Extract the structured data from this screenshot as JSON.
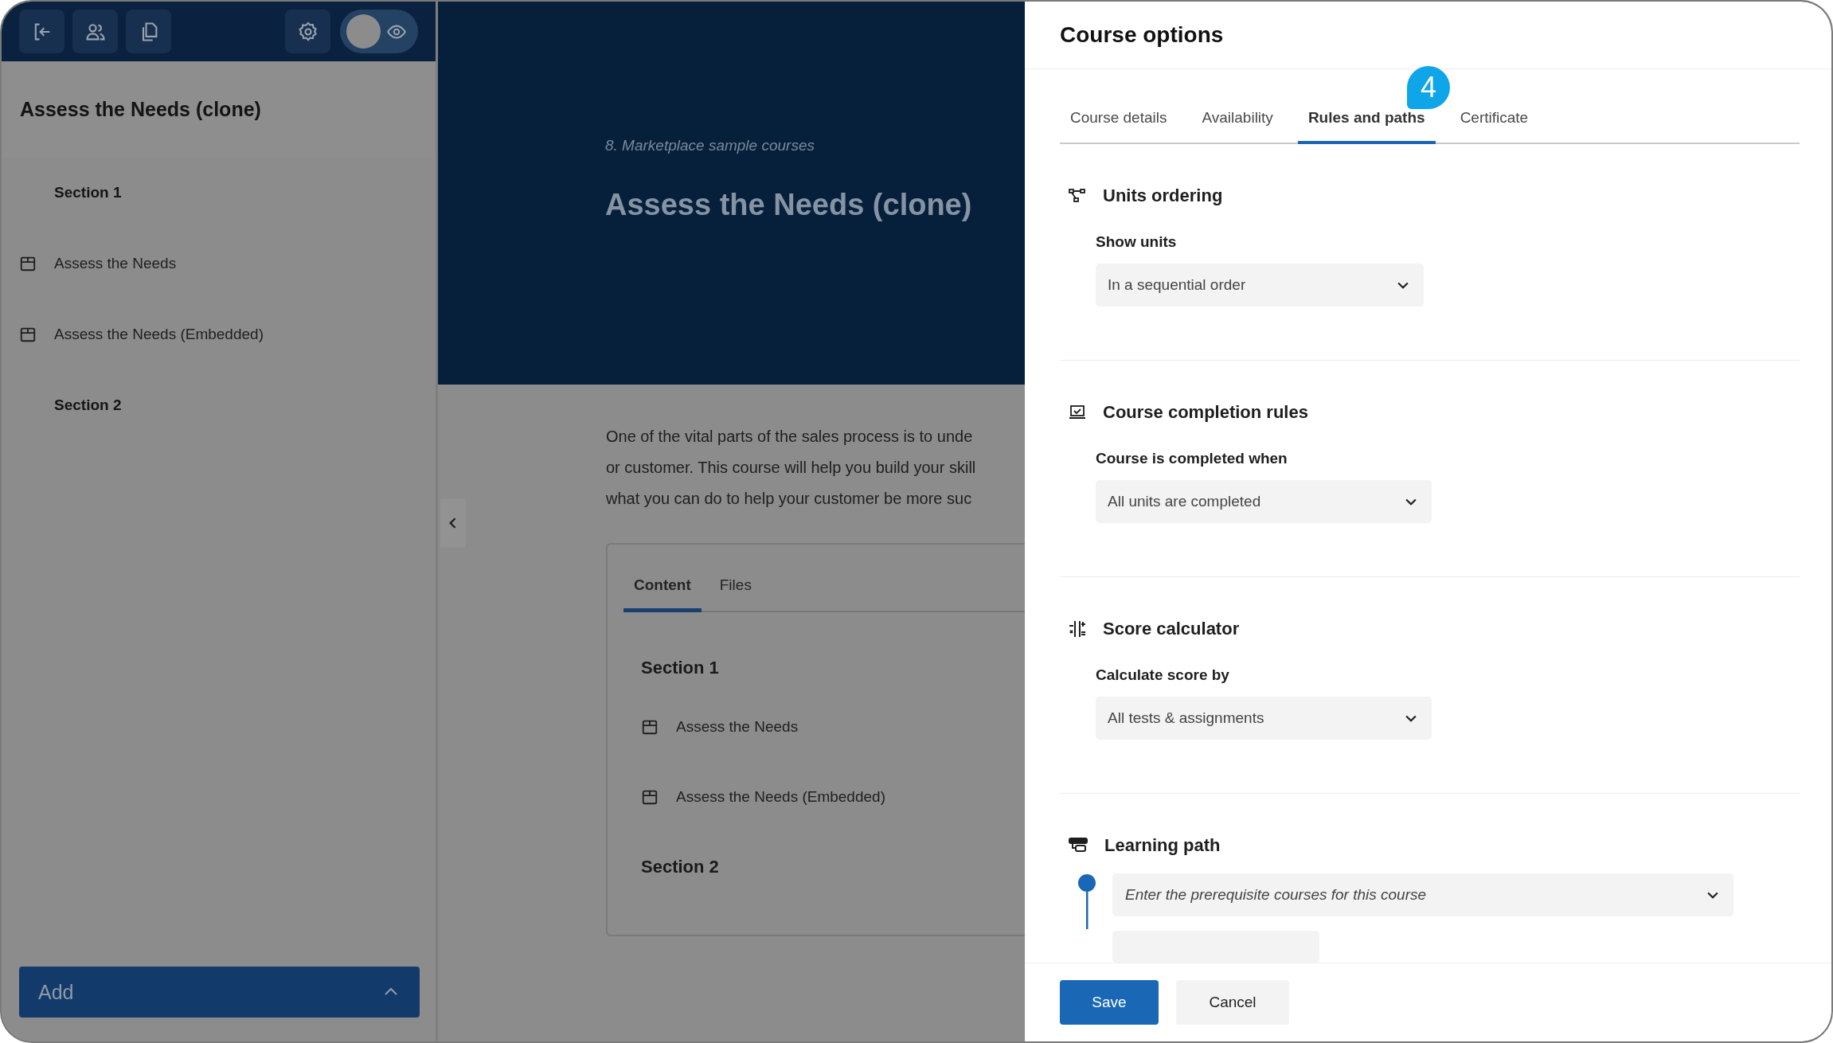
{
  "toolbar": {
    "preview_toggle": {
      "on": false
    }
  },
  "sidebar": {
    "title": "Assess the Needs (clone)",
    "items": [
      {
        "kind": "section",
        "label": "Section 1"
      },
      {
        "kind": "unit",
        "label": "Assess the Needs"
      },
      {
        "kind": "unit",
        "label": "Assess the Needs (Embedded)"
      },
      {
        "kind": "section",
        "label": "Section 2"
      }
    ],
    "add_button": {
      "label": "Add"
    }
  },
  "course": {
    "breadcrumb": "8. Marketplace sample courses",
    "title": "Assess the Needs (clone)",
    "description_lines": [
      "One of the vital parts of the sales process is to unde",
      "or customer. This course will help you build your skill",
      "what you can do to help your customer be more suc"
    ],
    "tabs": [
      {
        "label": "Content",
        "selected": true
      },
      {
        "label": "Files",
        "selected": false
      }
    ],
    "outline": [
      {
        "kind": "section",
        "label": "Section 1"
      },
      {
        "kind": "unit",
        "label": "Assess the Needs"
      },
      {
        "kind": "unit",
        "label": "Assess the Needs (Embedded)"
      },
      {
        "kind": "section",
        "label": "Section 2"
      }
    ]
  },
  "panel": {
    "title": "Course options",
    "tabs": [
      {
        "label": "Course details",
        "selected": false
      },
      {
        "label": "Availability",
        "selected": false
      },
      {
        "label": "Rules and paths",
        "selected": true
      },
      {
        "label": "Certificate",
        "selected": false
      }
    ],
    "callout": "4",
    "sections": [
      {
        "kind": "select",
        "title": "Units ordering",
        "field_label": "Show units",
        "value": "In a sequential order"
      },
      {
        "kind": "select",
        "title": "Course completion rules",
        "field_label": "Course is completed when",
        "value": "All units are completed"
      },
      {
        "kind": "select",
        "title": "Score calculator",
        "field_label": "Calculate score by",
        "value": "All tests & assignments"
      },
      {
        "kind": "path",
        "title": "Learning path",
        "placeholder": "Enter the prerequisite courses for this course"
      }
    ],
    "buttons": [
      {
        "kind": "primary",
        "label": "Save"
      },
      {
        "kind": "secondary",
        "label": "Cancel"
      }
    ]
  }
}
